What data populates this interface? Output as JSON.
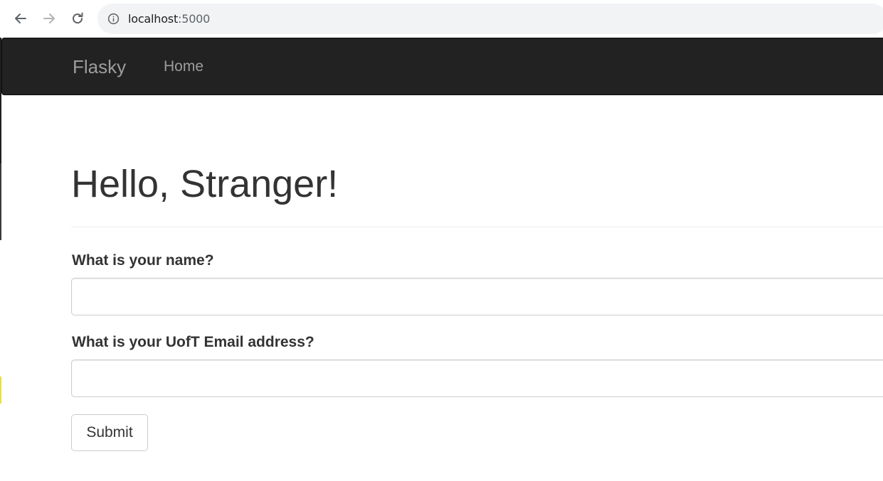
{
  "browser": {
    "url_host": "localhost",
    "url_port": ":5000",
    "icons": {
      "back": "arrow-left-icon",
      "forward": "arrow-right-icon",
      "reload": "reload-icon",
      "site_info": "info-circle-icon"
    }
  },
  "navbar": {
    "brand": "Flasky",
    "links": [
      {
        "label": "Home"
      }
    ],
    "background_color": "#222222",
    "text_color": "#9d9d9d"
  },
  "main": {
    "title": "Hello, Stranger!",
    "form": {
      "name_label": "What is your name?",
      "name_value": "",
      "email_label": "What is your UofT Email address?",
      "email_value": "",
      "submit_label": "Submit"
    }
  }
}
